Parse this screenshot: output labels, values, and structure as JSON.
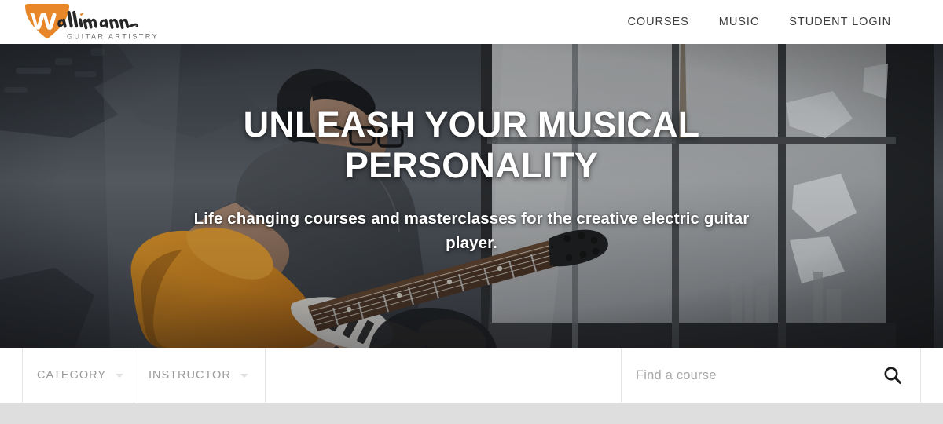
{
  "brand": {
    "name": "Wallimann",
    "tagline": "GUITAR ARTISTRY",
    "accent_color": "#E8862A",
    "logo_icon": "guitar-pick-logo"
  },
  "header": {
    "nav": [
      {
        "label": "COURSES"
      },
      {
        "label": "MUSIC"
      },
      {
        "label": "STUDENT LOGIN"
      }
    ]
  },
  "hero": {
    "title": "UNLEASH YOUR MUSICAL PERSONALITY",
    "subtitle": "Life changing courses and masterclasses for the creative electric guitar player.",
    "image_alt": "guitarist playing an orange electric guitar in a loft with large industrial windows",
    "text_color": "#ffffff"
  },
  "filter_bar": {
    "category": {
      "label": "CATEGORY",
      "icon": "chevron-down-icon"
    },
    "instructor": {
      "label": "INSTRUCTOR",
      "icon": "chevron-down-icon"
    },
    "search": {
      "value": "",
      "placeholder": "Find a course",
      "icon": "search-icon"
    },
    "divider_color": "#e6e6e6",
    "label_color": "#9a9a9a"
  },
  "bottom_strip": {
    "color": "#dedede"
  }
}
